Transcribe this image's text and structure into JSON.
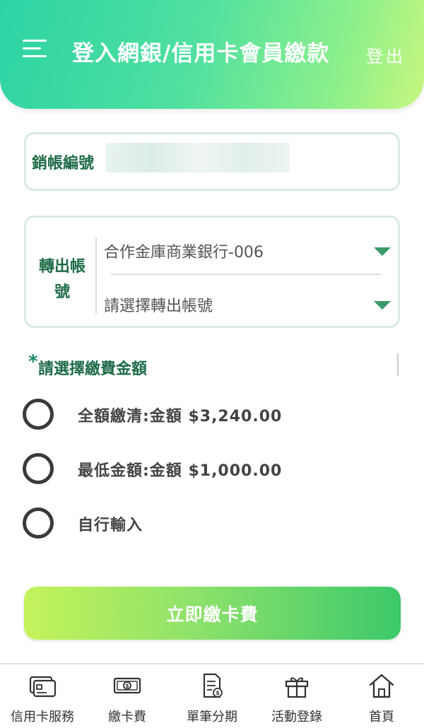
{
  "header": {
    "title": "登入網銀/信用卡會員繳款",
    "logout_label": "登出"
  },
  "account": {
    "label": "銷帳編號",
    "value": ""
  },
  "transfer": {
    "label_line1": "轉出帳",
    "label_line2": "號",
    "bank_select": "合作金庫商業銀行-006",
    "account_select": "請選擇轉出帳號"
  },
  "amount": {
    "asterisk": "*",
    "title": "請選擇繳費金額",
    "options": [
      {
        "label": "全額繳清:金額 $3,240.00",
        "selected": false
      },
      {
        "label": "最低金額:金額 $1,000.00",
        "selected": false
      },
      {
        "label": "自行輸入",
        "selected": false
      }
    ]
  },
  "pay_button": {
    "label": "立即繳卡費"
  },
  "bottom_nav": {
    "items": [
      {
        "label": "信用卡服務",
        "icon": "credit-card-icon"
      },
      {
        "label": "繳卡費",
        "icon": "cash-icon"
      },
      {
        "label": "單筆分期",
        "icon": "document-coin-icon"
      },
      {
        "label": "活動登錄",
        "icon": "gift-icon"
      },
      {
        "label": "首頁",
        "icon": "home-icon"
      }
    ]
  },
  "colors": {
    "accent_green": "#1e6b48",
    "header_gradient_start": "#2dd3a4",
    "header_gradient_end": "#c8f77e",
    "button_gradient_start": "#c4f35a",
    "button_gradient_end": "#3cc96a"
  }
}
